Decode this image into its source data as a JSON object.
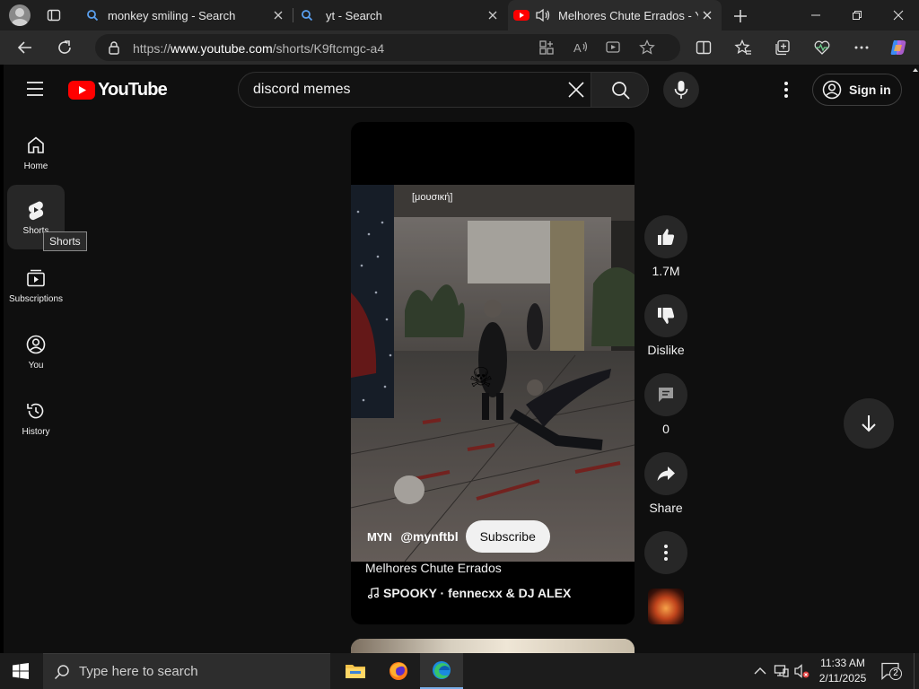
{
  "browser": {
    "tabs": [
      {
        "title": "monkey smiling - Search"
      },
      {
        "title": "yt - Search"
      },
      {
        "title": "Melhores Chute Errados - Yo"
      }
    ],
    "url_prefix": "https://",
    "url_domain": "www.youtube.com",
    "url_path": "/shorts/K9ftcmgc-a4"
  },
  "youtube": {
    "logo_text": "YouTube",
    "search_value": "discord memes",
    "sign_in_label": "Sign in",
    "sidebar": [
      {
        "label": "Home"
      },
      {
        "label": "Shorts"
      },
      {
        "label": "Subscriptions"
      },
      {
        "label": "You"
      },
      {
        "label": "History"
      }
    ],
    "tooltip": "Shorts",
    "short": {
      "overlay_tag": "[μουσική]",
      "channel_badge": "MYN",
      "channel_handle": "@mynftbl",
      "subscribe_label": "Subscribe",
      "title": "Melhores Chute Errados",
      "music": "SPOOKY · fennecxx & DJ ALEX"
    },
    "actions": {
      "likes": "1.7M",
      "dislike_label": "Dislike",
      "comments": "0",
      "share_label": "Share"
    }
  },
  "taskbar": {
    "search_placeholder": "Type here to search",
    "time": "11:33 AM",
    "date": "2/11/2025",
    "notifications": "2"
  },
  "colors": {
    "brand_red": "#ff0000",
    "page_bg": "#0f0f0f",
    "accent_blue": "#3ea6ff"
  }
}
